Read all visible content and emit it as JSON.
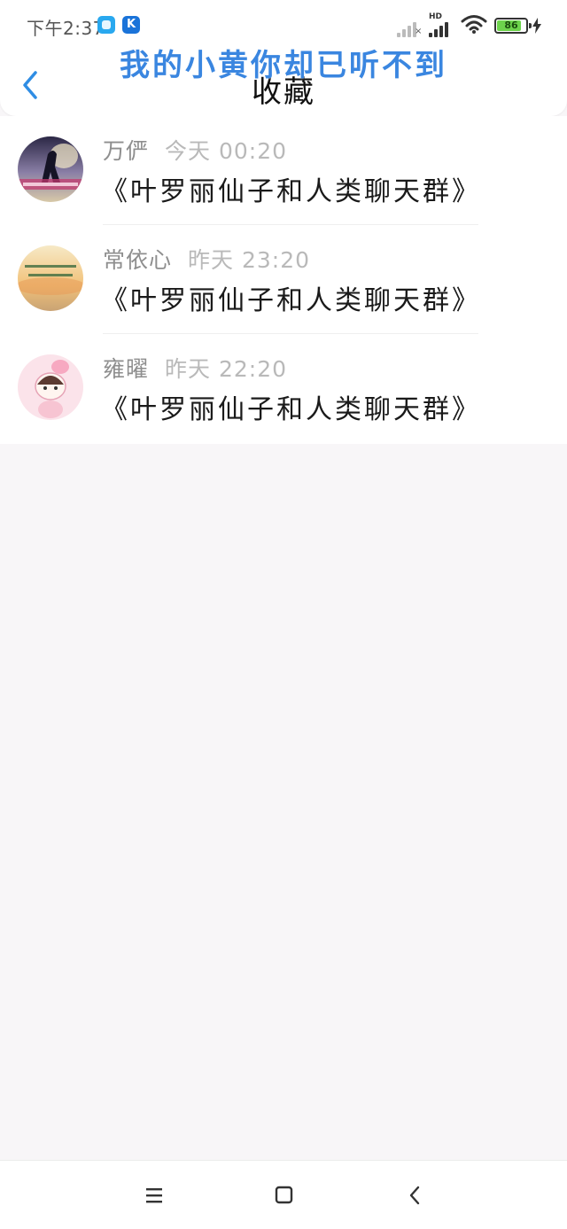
{
  "status_bar": {
    "time": "下午2:37",
    "app_icon_b_letter": "K",
    "battery_level": 86,
    "battery_text": "86",
    "network_label": "HD",
    "colors": {
      "battery_fill": "#6dd34c",
      "app_icon_a": "#29a8ef",
      "app_icon_b": "#1a73d9"
    }
  },
  "header": {
    "overlay_caption": "我的小黄你却已听不到",
    "title": "收藏",
    "back_icon": "chevron-left-icon",
    "colors": {
      "back": "#2f8de4",
      "caption": "#3a86e0"
    }
  },
  "favorites": [
    {
      "name": "万俨",
      "time": "今天 00:20",
      "text": "《叶罗丽仙子和人类聊天群》",
      "avatar": "avatar-dusk-silhouette"
    },
    {
      "name": "常依心",
      "time": "昨天 23:20",
      "text": "《叶罗丽仙子和人类聊天群》",
      "avatar": "avatar-sunset-quote"
    },
    {
      "name": "雍曜",
      "time": "昨天 22:20",
      "text": "《叶罗丽仙子和人类聊天群》",
      "avatar": "avatar-pink-cartoon"
    }
  ],
  "nav_bar": {
    "menu_icon": "menu-icon",
    "home_icon": "home-square-icon",
    "back_icon": "back-chevron-icon"
  }
}
